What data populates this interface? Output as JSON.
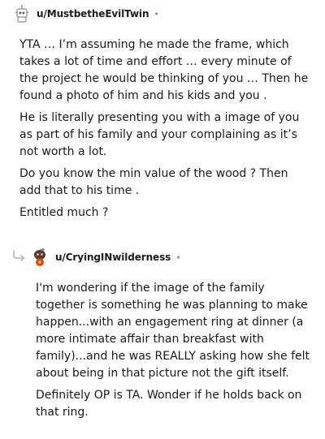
{
  "comments": [
    {
      "username": "u/MustbetheEvilTwin",
      "separator": "•",
      "paragraphs": [
        "YTA … I’m assuming he made the frame, which takes a lot of time and effort … every minute of the project he would be thinking of you … Then he found a photo of him and his kids and you .",
        "He is literally presenting you with a image of you as part of his family and your complaining as it’s not worth a lot.",
        "Do you know the min value of the wood ? Then add that to his time .",
        "Entitled much ?"
      ]
    },
    {
      "username": "u/CryingINwilderness",
      "separator": "•",
      "paragraphs": [
        "I'm wondering if the image of the family together is something he was planning to make happen...with an engagement ring at dinner (a more intimate affair than breakfast with family)...and he was REALLY asking how she felt about being in that picture not the gift itself.",
        "Definitely OP is TA. Wonder if he holds back on that ring."
      ]
    }
  ]
}
